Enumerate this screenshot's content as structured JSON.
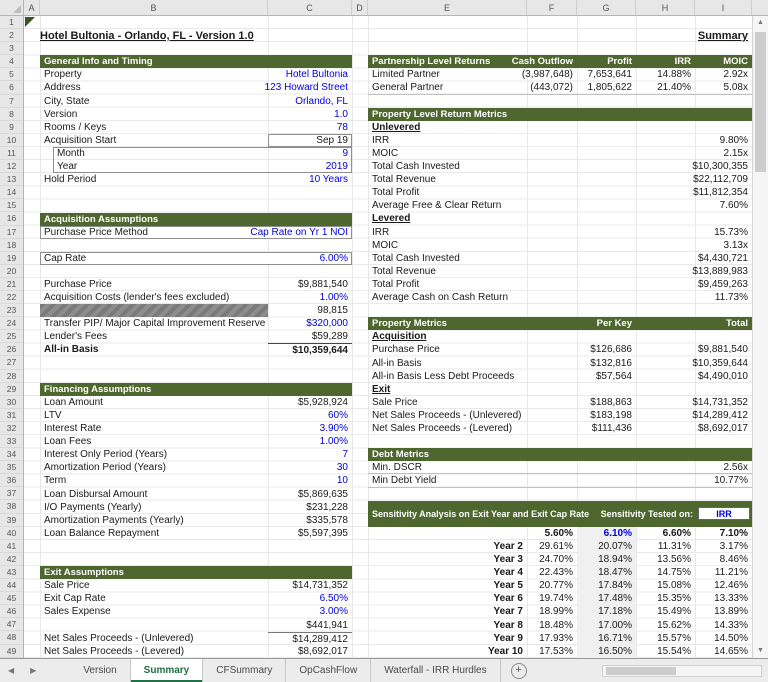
{
  "chrome": {
    "column_letters": [
      "A",
      "B",
      "C",
      "D",
      "E",
      "F",
      "G",
      "H",
      "I"
    ],
    "row_count": 49,
    "icons": {
      "tab_scroll_left": "◀",
      "tab_scroll_right": "▶",
      "scroll_up": "▲",
      "scroll_down": "▼",
      "new_sheet": "+"
    },
    "tabs": [
      {
        "label": "Version"
      },
      {
        "label": "Summary",
        "cls": "active"
      },
      {
        "label": "CFSummary"
      },
      {
        "label": "OpCashFlow"
      },
      {
        "label": "Waterfall - IRR Hurdles"
      }
    ]
  },
  "title_bar": {
    "title": "Hotel Bultonia - Orlando, FL - Version 1.0",
    "sheet_label": "Summary"
  },
  "general_info": {
    "header": "General Info and Timing",
    "rows": [
      {
        "label": "Property",
        "value": "Hotel Bultonia",
        "cls": "blue"
      },
      {
        "label": "Address",
        "value": "123 Howard Street",
        "cls": "blue"
      },
      {
        "label": "City, State",
        "value": "Orlando, FL",
        "cls": "blue"
      },
      {
        "label": "Version",
        "value": "1.0",
        "cls": "blue"
      },
      {
        "label": "Rooms / Keys",
        "value": "78",
        "cls": "blue"
      },
      {
        "label": "Acquisition Start",
        "value": "Sep 19",
        "cls": "valbox"
      },
      {
        "label": "Month",
        "value": "9",
        "cls": "blue indent gb gb-top"
      },
      {
        "label": "Year",
        "value": "2019",
        "cls": "blue indent gb gb-bot"
      },
      {
        "label": "Hold Period",
        "value": "10 Years",
        "cls": "blue"
      }
    ]
  },
  "acquisition": {
    "header": "Acquisition Assumptions",
    "rows": [
      {
        "label": "Purchase Price Method",
        "value": "Cap Rate on Yr 1 NOI",
        "cls": "blue boxed"
      },
      {
        "label": "",
        "value": "",
        "cls": "blank"
      },
      {
        "label": "Cap Rate",
        "value": "6.00%",
        "cls": "blue boxed"
      },
      {
        "label": "",
        "value": "",
        "cls": "blank"
      },
      {
        "label": "Purchase Price",
        "value": "$9,881,540"
      },
      {
        "label": "Acquisition Costs (lender's fees excluded)",
        "value": "1.00%",
        "cls": "blue"
      },
      {
        "label": "",
        "value": "98,815",
        "cls": "graybar"
      },
      {
        "label": "Transfer PIP/ Major Capital Improvement Reserve",
        "value": "$320,000",
        "cls": "blue"
      },
      {
        "label": "Lender's Fees",
        "value": "$59,289"
      },
      {
        "label": "All-in Basis",
        "value": "$10,359,644",
        "cls": "total"
      }
    ]
  },
  "financing": {
    "header": "Financing Assumptions",
    "rows": [
      {
        "label": "Loan Amount",
        "value": "$5,928,924"
      },
      {
        "label": "LTV",
        "value": "60%",
        "cls": "blue"
      },
      {
        "label": "Interest Rate",
        "value": "3.90%",
        "cls": "blue"
      },
      {
        "label": "Loan Fees",
        "value": "1.00%",
        "cls": "blue"
      },
      {
        "label": "Interest Only Period (Years)",
        "value": "7",
        "cls": "blue"
      },
      {
        "label": "Amortization Period (Years)",
        "value": "30",
        "cls": "blue"
      },
      {
        "label": "Term",
        "value": "10",
        "cls": "blue"
      },
      {
        "label": "Loan Disbursal Amount",
        "value": "$5,869,635"
      },
      {
        "label": "I/O Payments (Yearly)",
        "value": "$231,228"
      },
      {
        "label": "Amortization Payments (Yearly)",
        "value": "$335,578"
      },
      {
        "label": "Loan Balance Repayment",
        "value": "$5,597,395"
      }
    ]
  },
  "exit_assumptions": {
    "header": "Exit Assumptions",
    "rows": [
      {
        "label": "Sale Price",
        "value": "$14,731,352"
      },
      {
        "label": "Exit Cap Rate",
        "value": "6.50%",
        "cls": "blue"
      },
      {
        "label": "Sales Expense",
        "value": "3.00%",
        "cls": "blue"
      },
      {
        "label": "",
        "value": "$441,941"
      },
      {
        "label": "Net Sales Proceeds - (Unlevered)",
        "value": "$14,289,412",
        "cls": "topline"
      },
      {
        "label": "Net Sales Proceeds - (Levered)",
        "value": "$8,692,017"
      }
    ]
  },
  "partnership": {
    "header": "Partnership Level Returns",
    "col_headers": [
      "Cash Outflow",
      "Profit",
      "IRR",
      "MOIC"
    ],
    "rows": [
      {
        "label": "Limited Partner",
        "values": [
          "(3,987,648)",
          "7,653,641",
          "14.88%",
          "2.92x"
        ]
      },
      {
        "label": "General Partner",
        "values": [
          "(443,072)",
          "1,805,622",
          "21.40%",
          "5.08x"
        ],
        "cls": "botline"
      }
    ]
  },
  "property_level": {
    "header": "Property Level Return Metrics",
    "rows": [
      {
        "label": "Unlevered",
        "value": "",
        "cls": "subhead"
      },
      {
        "label": "IRR",
        "value": "9.80%"
      },
      {
        "label": "MOIC",
        "value": "2.15x"
      },
      {
        "label": "Total Cash Invested",
        "value": "$10,300,355"
      },
      {
        "label": "Total Revenue",
        "value": "$22,112,709"
      },
      {
        "label": "Total Profit",
        "value": "$11,812,354"
      },
      {
        "label": "Average Free & Clear Return",
        "value": "7.60%"
      },
      {
        "label": "Levered",
        "value": "",
        "cls": "subhead"
      },
      {
        "label": "IRR",
        "value": "15.73%"
      },
      {
        "label": "MOIC",
        "value": "3.13x"
      },
      {
        "label": "Total Cash Invested",
        "value": "$4,430,721"
      },
      {
        "label": "Total Revenue",
        "value": "$13,889,983"
      },
      {
        "label": "Total Profit",
        "value": "$9,459,263"
      },
      {
        "label": "Average Cash on Cash Return",
        "value": "11.73%"
      }
    ]
  },
  "property_metrics": {
    "header": "Property Metrics",
    "col_headers": [
      "Per Key",
      "Total"
    ],
    "rows": [
      {
        "label": "Acquisition",
        "values": [
          "",
          ""
        ],
        "cls": "subhead"
      },
      {
        "label": "Purchase Price",
        "values": [
          "$126,686",
          "$9,881,540"
        ]
      },
      {
        "label": "All-in Basis",
        "values": [
          "$132,816",
          "$10,359,644"
        ]
      },
      {
        "label": "All-in Basis Less Debt Proceeds",
        "values": [
          "$57,564",
          "$4,490,010"
        ]
      },
      {
        "label": "Exit",
        "values": [
          "",
          ""
        ],
        "cls": "subhead"
      },
      {
        "label": "Sale Price",
        "values": [
          "$188,863",
          "$14,731,352"
        ]
      },
      {
        "label": "Net Sales Proceeds - (Unlevered)",
        "values": [
          "$183,198",
          "$14,289,412"
        ]
      },
      {
        "label": "Net Sales Proceeds - (Levered)",
        "values": [
          "$111,436",
          "$8,692,017"
        ]
      }
    ]
  },
  "debt_metrics": {
    "header": "Debt Metrics",
    "rows": [
      {
        "label": "Min. DSCR",
        "value": "2.56x",
        "cls": "botline"
      },
      {
        "label": "Min Debt Yield",
        "value": "10.77%",
        "cls": "botline"
      }
    ]
  },
  "sensitivity": {
    "header": "Sensitivity Analysis on Exit Year and Exit Cap Rate",
    "tested_on_label": "Sensitivity Tested on:",
    "tested_on_value": "IRR",
    "cap_rates": [
      "5.60%",
      "6.10%",
      "6.60%",
      "7.10%"
    ],
    "highlight_col": 1,
    "rows": [
      {
        "label": "Year 2",
        "values": [
          "29.61%",
          "20.07%",
          "11.31%",
          "3.17%"
        ]
      },
      {
        "label": "Year 3",
        "values": [
          "24.70%",
          "18.94%",
          "13.56%",
          "8.46%"
        ]
      },
      {
        "label": "Year 4",
        "values": [
          "22.43%",
          "18.47%",
          "14.75%",
          "11.21%"
        ]
      },
      {
        "label": "Year 5",
        "values": [
          "20.77%",
          "17.84%",
          "15.08%",
          "12.46%"
        ]
      },
      {
        "label": "Year 6",
        "values": [
          "19.74%",
          "17.48%",
          "15.35%",
          "13.33%"
        ]
      },
      {
        "label": "Year 7",
        "values": [
          "18.99%",
          "17.18%",
          "15.49%",
          "13.89%"
        ]
      },
      {
        "label": "Year 8",
        "values": [
          "18.48%",
          "17.00%",
          "15.62%",
          "14.33%"
        ]
      },
      {
        "label": "Year 9",
        "values": [
          "17.93%",
          "16.71%",
          "15.57%",
          "14.50%"
        ]
      },
      {
        "label": "Year 10",
        "values": [
          "17.53%",
          "16.50%",
          "15.54%",
          "14.65%"
        ]
      }
    ]
  },
  "colors": {
    "section_header_green": "#4e672e",
    "input_blue": "#0000e0",
    "active_tab_green": "#1f7244",
    "highlight_fill": "#f0f0f0"
  }
}
